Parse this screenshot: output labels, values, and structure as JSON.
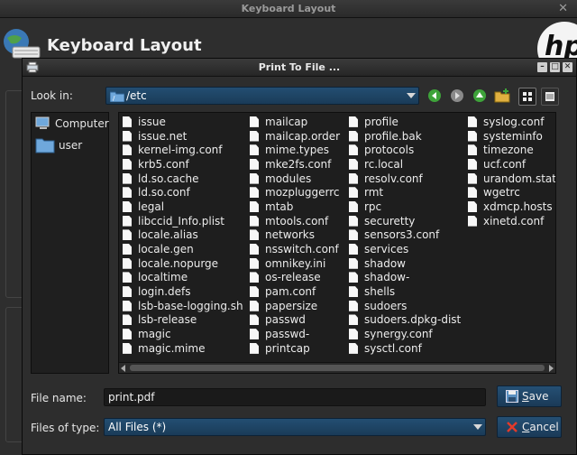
{
  "background": {
    "window_title": "Keyboard Layout",
    "heading": "Keyboard Layout"
  },
  "dialog": {
    "title": "Print To File ...",
    "look_in_label": "Look in:",
    "look_in_value": "/etc",
    "sidebar": [
      {
        "label": "Computer",
        "icon": "computer-icon"
      },
      {
        "label": "user",
        "icon": "folder-icon"
      }
    ],
    "file_columns": [
      [
        "issue",
        "issue.net",
        "kernel-img.conf",
        "krb5.conf",
        "ld.so.cache",
        "ld.so.conf",
        "legal",
        "libccid_Info.plist",
        "locale.alias",
        "locale.gen",
        "locale.nopurge",
        "localtime",
        "login.defs",
        "lsb-base-logging.sh",
        "lsb-release",
        "magic",
        "magic.mime"
      ],
      [
        "mailcap",
        "mailcap.order",
        "mime.types",
        "mke2fs.conf",
        "modules",
        "mozpluggerrc",
        "mtab",
        "mtools.conf",
        "networks",
        "nsswitch.conf",
        "omnikey.ini",
        "os-release",
        "pam.conf",
        "papersize",
        "passwd",
        "passwd-",
        "printcap"
      ],
      [
        "profile",
        "profile.bak",
        "protocols",
        "rc.local",
        "resolv.conf",
        "rmt",
        "rpc",
        "securetty",
        "sensors3.conf",
        "services",
        "shadow",
        "shadow-",
        "shells",
        "sudoers",
        "sudoers.dpkg-dist",
        "synergy.conf",
        "sysctl.conf"
      ],
      [
        "syslog.conf",
        "systeminfo",
        "timezone",
        "ucf.conf",
        "urandom.state",
        "wgetrc",
        "xdmcp.hosts",
        "xinetd.conf"
      ]
    ],
    "file_name_label": "File name:",
    "file_name_value": "print.pdf",
    "file_type_label": "Files of type:",
    "file_type_value": "All Files (*)",
    "save_label": "Save",
    "cancel_label": "Cancel"
  },
  "colors": {
    "accent": "#1f4466",
    "background": "#2d2d2d",
    "list_bg": "#1e1e1e"
  }
}
